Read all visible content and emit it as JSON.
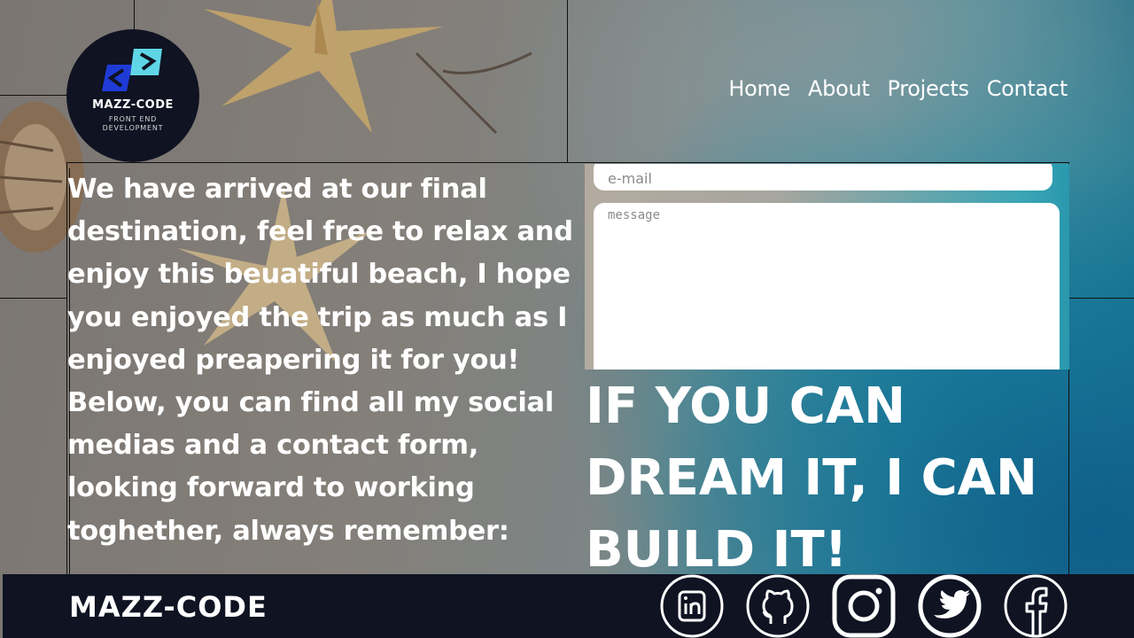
{
  "logo": {
    "title": "MAZZ-CODE",
    "subtitle": "FRONT END DEVELOPMENT",
    "accent_dark": "#1f3bd6",
    "accent_light": "#5fd6e6"
  },
  "nav": {
    "items": [
      {
        "label": "Home"
      },
      {
        "label": "About"
      },
      {
        "label": "Projects"
      },
      {
        "label": "Contact"
      }
    ]
  },
  "main": {
    "intro_text": " We have arrived at our final destination, feel free to relax and enjoy this beuatiful beach, I hope you enjoyed the trip as much as I enjoyed preapering it for you! Below, you can find all my social medias and a contact form, looking forward to working toghether, always  remember:",
    "slogan": "IF YOU CAN DREAM IT, I CAN BUILD IT!"
  },
  "form": {
    "email_placeholder": "e-mail",
    "message_placeholder": "message"
  },
  "footer": {
    "brand": "MAZZ-CODE",
    "socials": [
      {
        "icon": "linkedin-icon"
      },
      {
        "icon": "github-icon"
      },
      {
        "icon": "instagram-icon"
      },
      {
        "icon": "twitter-icon"
      },
      {
        "icon": "facebook-icon"
      }
    ]
  },
  "colors": {
    "dark_navy": "#0f1322",
    "text": "#ffffff"
  }
}
